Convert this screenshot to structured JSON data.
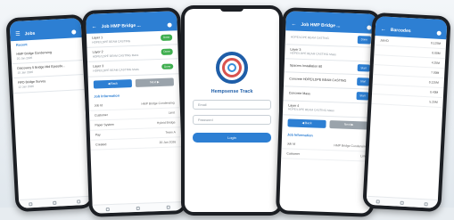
{
  "phone1": {
    "title": "Jobs",
    "section": "Recent",
    "items": [
      {
        "name": "HMP Bridge Condensing",
        "date": "20 Jan 2026"
      },
      {
        "name": "Discovery 5 Bridge Mid Episode...",
        "date": "15 Jan 2026"
      },
      {
        "name": "RFD Bridge Survey",
        "date": "12 Jan 2026"
      }
    ]
  },
  "phone2": {
    "title": "Job HMP Bridge ...",
    "layers": [
      {
        "label": "Layer 1",
        "desc": "HDPE/LDPE BEAM CASTING",
        "badge": "Done"
      },
      {
        "label": "Layer 2",
        "desc": "HDPE/LDPE BEAM CASTING Mass",
        "badge": "Done"
      },
      {
        "label": "Layer 3",
        "desc": "HDPE/LDPE BEAM CASTING Mass",
        "badge": "Done"
      }
    ],
    "btn_left": "◀ Back",
    "btn_right": "Next ▶",
    "info_label": "Job Information",
    "fields": [
      {
        "k": "Job Id",
        "v": "HMP Bridge Condensing"
      },
      {
        "k": "Customer",
        "v": "Limit"
      },
      {
        "k": "Paper System",
        "v": "Hybrid Bridge"
      },
      {
        "k": "Pay",
        "v": "Team A"
      },
      {
        "k": "Created",
        "v": "20 Jan 2026"
      }
    ]
  },
  "login": {
    "app_name": "Hempsense Track",
    "email_placeholder": "Email",
    "password_placeholder": "Password",
    "login_label": "Login"
  },
  "phone4": {
    "title": "Job HMP Bridge ...",
    "top_desc": "HDPE/LDPE BEAM CASTING",
    "top_btn": "Done",
    "layer_label": "Layer 3",
    "layer_desc": "HDPE/LDPE BEAM CASTING Mass",
    "steps": [
      {
        "label": "Spacers Installation 60",
        "btn": "Start"
      },
      {
        "label": "Concrete HDPE/LDPE BEAM CASTING",
        "btn": "Start"
      },
      {
        "label": "Concrete Mass",
        "btn": "Start"
      }
    ],
    "layer4_label": "Layer 4",
    "layer4_desc": "HDPE/LDPE BEAM CASTING Mass",
    "btn_left": "◀ Back",
    "btn_right": "Next ▶",
    "info_label": "Job Information",
    "fields": [
      {
        "k": "Job Id",
        "v": "HMP Bridge Condensing"
      },
      {
        "k": "Customer",
        "v": "Limit"
      }
    ]
  },
  "phone5": {
    "title": "Barcodes",
    "rows": [
      {
        "k": "Job ID",
        "v": "0.125M"
      },
      {
        "k": "",
        "v": "0.00M"
      },
      {
        "k": "",
        "v": "4.25M"
      },
      {
        "k": "",
        "v": "7.00M"
      },
      {
        "k": "",
        "v": "0.125M"
      },
      {
        "k": "",
        "v": "0.43M"
      },
      {
        "k": "",
        "v": "5.25M"
      }
    ]
  }
}
